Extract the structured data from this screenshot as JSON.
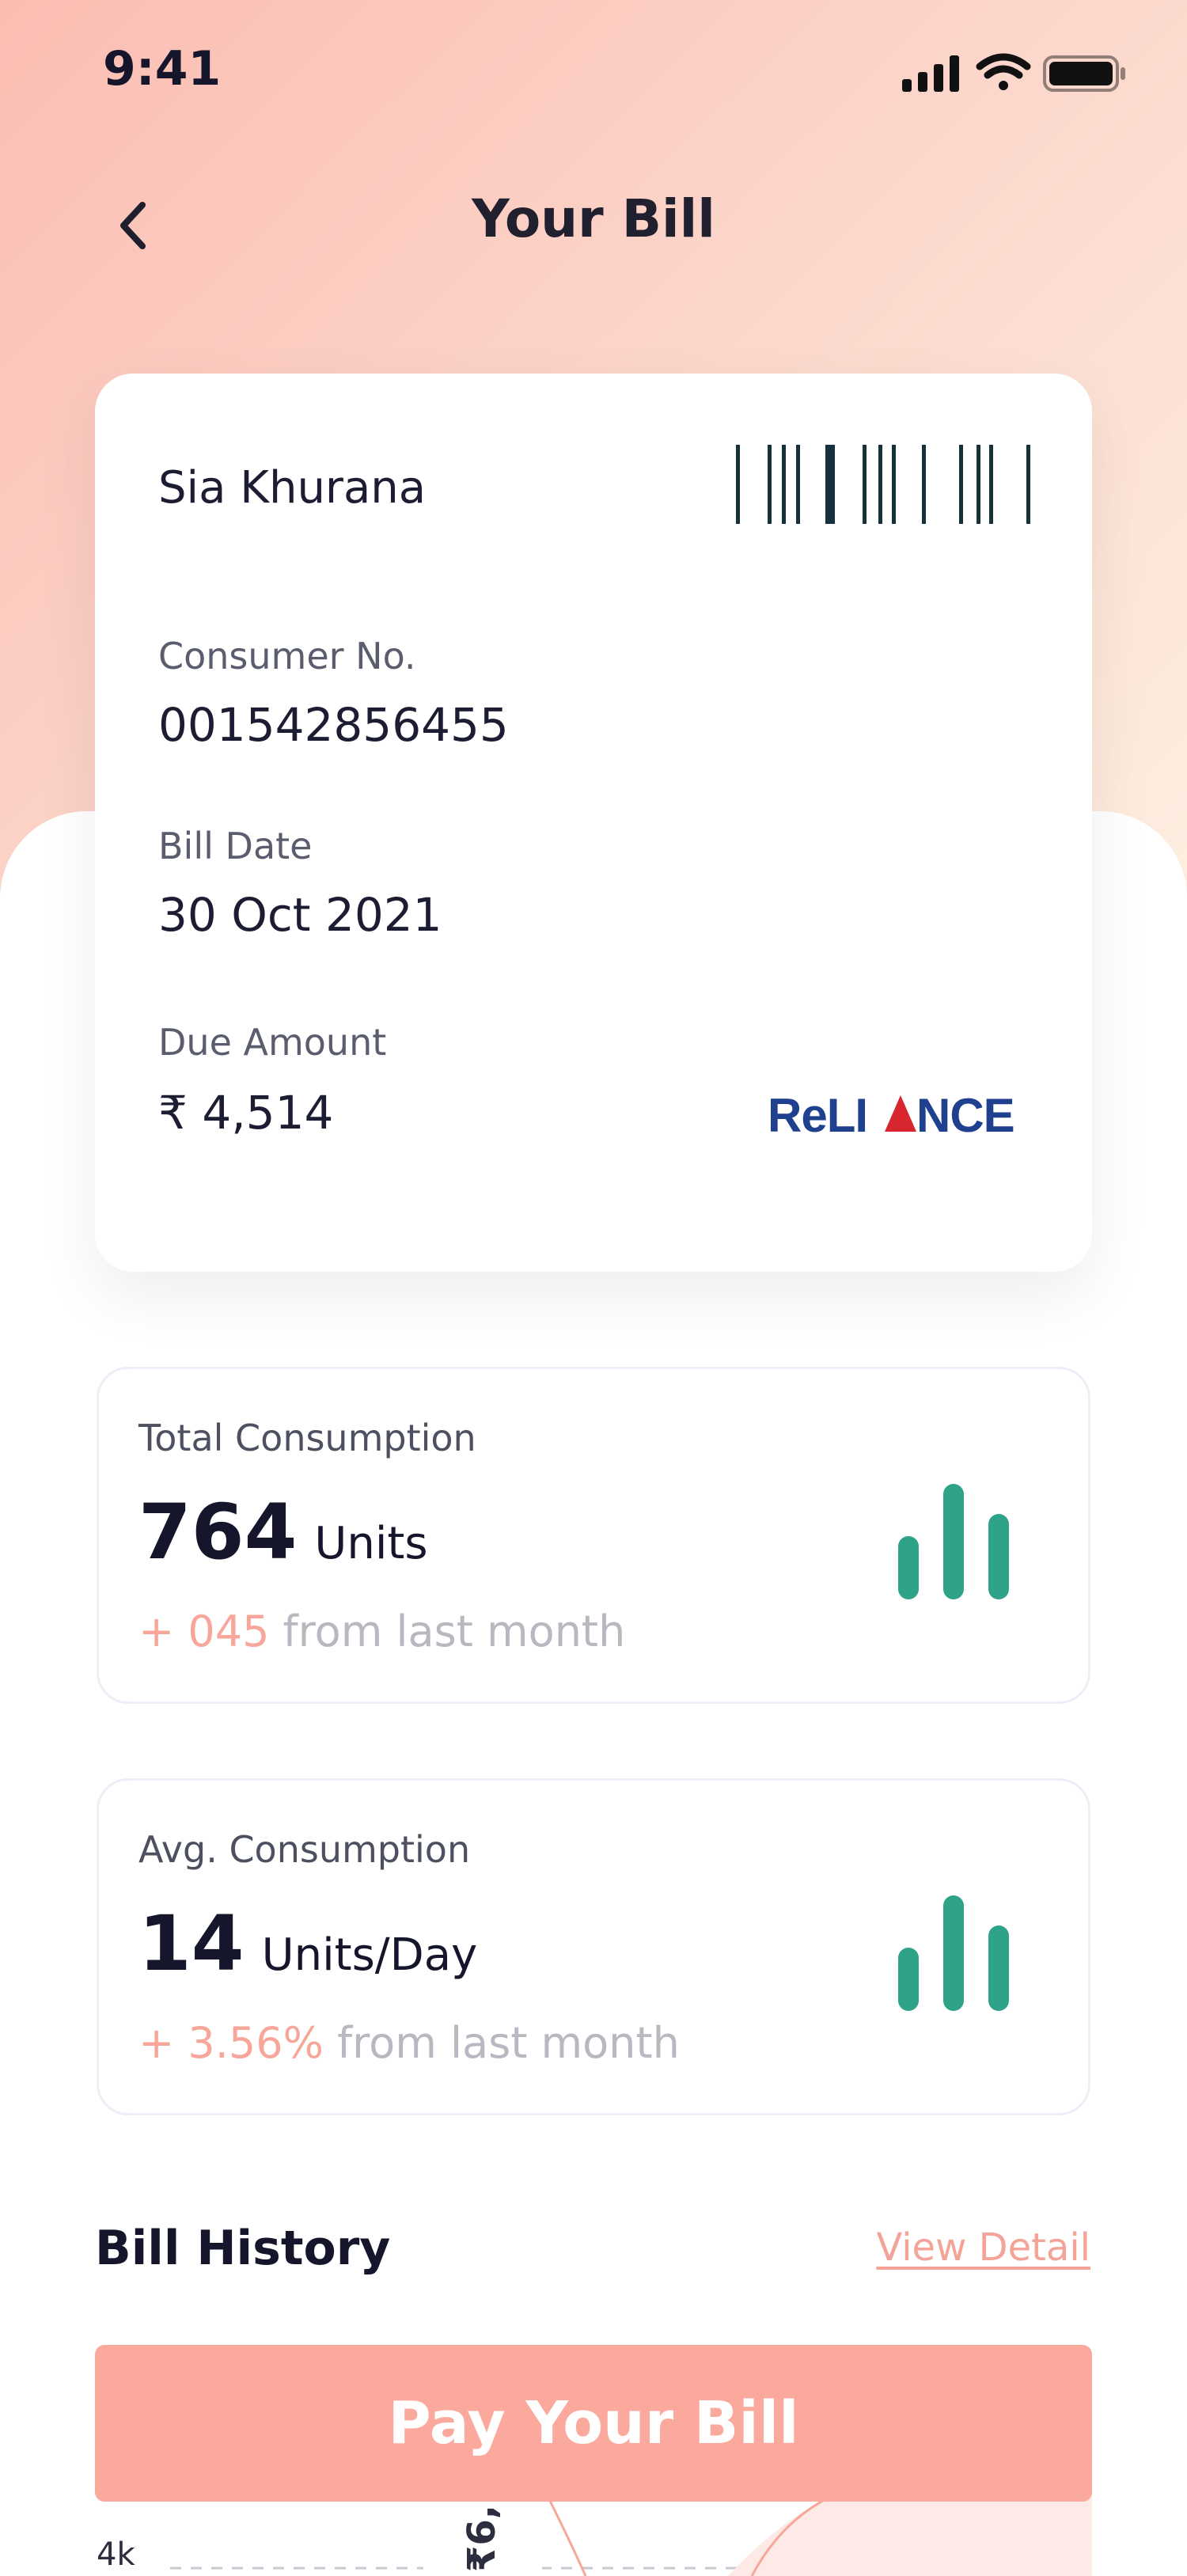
{
  "status_bar": {
    "time": "9:41"
  },
  "header": {
    "title": "Your Bill"
  },
  "bill": {
    "customer_name": "Sia Khurana",
    "consumer_no_label": "Consumer No.",
    "consumer_no": "001542856455",
    "bill_date_label": "Bill Date",
    "bill_date": "30 Oct 2021",
    "due_amount_label": "Due Amount",
    "due_amount": "₹ 4,514",
    "provider": "RELIANCE"
  },
  "stats": [
    {
      "title": "Total Consumption",
      "value": "764",
      "unit": "Units",
      "delta": "+ 045",
      "delta_text": "from last month"
    },
    {
      "title": "Avg. Consumption",
      "value": "14",
      "unit": "Units/Day",
      "delta": "+ 3.56%",
      "delta_text": "from last month"
    }
  ],
  "history": {
    "title": "Bill History",
    "view_detail": "View Detail",
    "axis_label": "4k",
    "tooltip_value": "₹6,"
  },
  "pay_button": {
    "label": "Pay Your Bill"
  },
  "colors": {
    "accent": "#fba89d",
    "chart_green": "#2fa38a",
    "delta_pink": "#f7a79a"
  }
}
